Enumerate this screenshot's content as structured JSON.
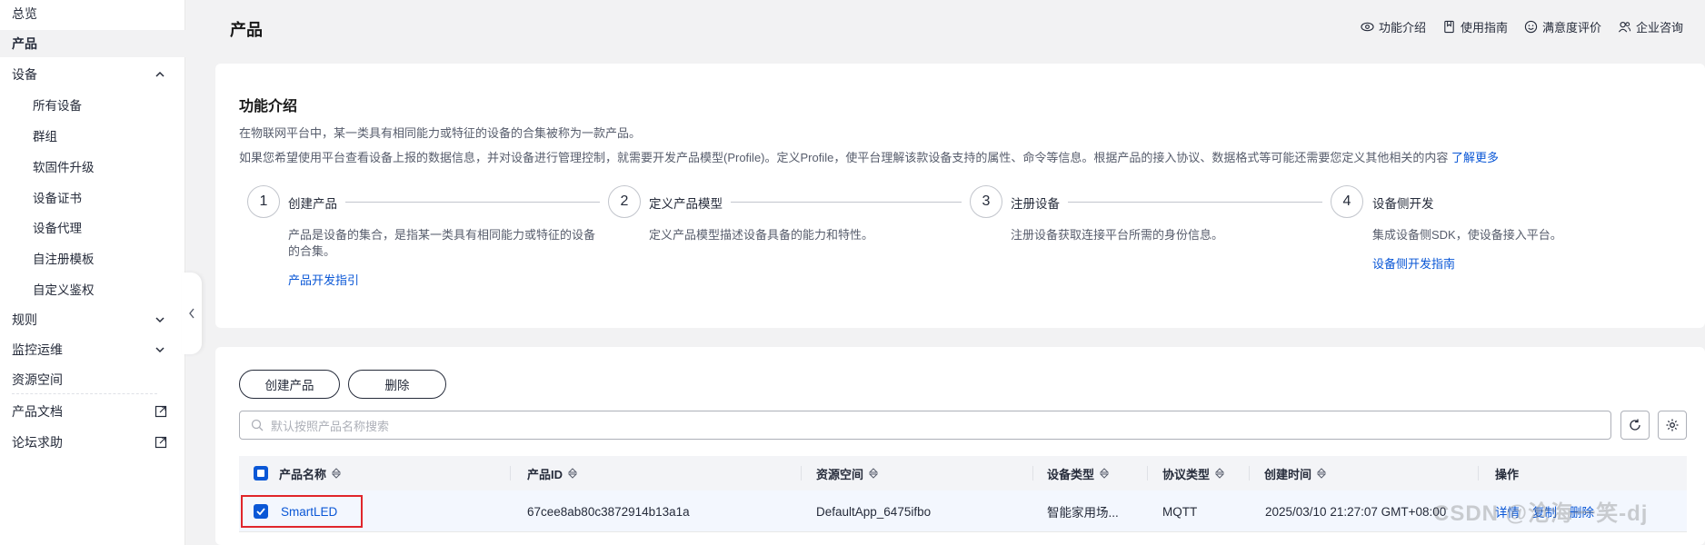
{
  "sidebar": {
    "items": [
      {
        "label": "总览"
      },
      {
        "label": "产品"
      },
      {
        "label": "设备"
      },
      {
        "label": "所有设备"
      },
      {
        "label": "群组"
      },
      {
        "label": "软固件升级"
      },
      {
        "label": "设备证书"
      },
      {
        "label": "设备代理"
      },
      {
        "label": "自注册模板"
      },
      {
        "label": "自定义鉴权"
      },
      {
        "label": "规则"
      },
      {
        "label": "监控运维"
      },
      {
        "label": "资源空间"
      },
      {
        "label": "产品文档"
      },
      {
        "label": "论坛求助"
      }
    ]
  },
  "header": {
    "title": "产品",
    "links": [
      "功能介绍",
      "使用指南",
      "满意度评价",
      "企业咨询"
    ]
  },
  "intro": {
    "title": "功能介绍",
    "p1": "在物联网平台中，某一类具有相同能力或特征的设备的合集被称为一款产品。",
    "p2": "如果您希望使用平台查看设备上报的数据信息，并对设备进行管理控制，就需要开发产品模型(Profile)。定义Profile，使平台理解该款设备支持的属性、命令等信息。根据产品的接入协议、数据格式等可能还需要您定义其他相关的内容",
    "p2_link": "了解更多",
    "steps": [
      {
        "num": "1",
        "title": "创建产品",
        "desc": "产品是设备的集合，是指某一类具有相同能力或特征的设备的合集。",
        "link": "产品开发指引"
      },
      {
        "num": "2",
        "title": "定义产品模型",
        "desc": "定义产品模型描述设备具备的能力和特性。",
        "link": ""
      },
      {
        "num": "3",
        "title": "注册设备",
        "desc": "注册设备获取连接平台所需的身份信息。",
        "link": ""
      },
      {
        "num": "4",
        "title": "设备侧开发",
        "desc": "集成设备侧SDK，使设备接入平台。",
        "link": "设备侧开发指南"
      }
    ]
  },
  "list": {
    "create_label": "创建产品",
    "delete_label": "删除",
    "search_placeholder": "默认按照产品名称搜索",
    "columns": [
      "产品名称",
      "产品ID",
      "资源空间",
      "设备类型",
      "协议类型",
      "创建时间",
      "操作"
    ],
    "rows": [
      {
        "name": "SmartLED",
        "id": "67cee8ab80c3872914b13a1a",
        "space": "DefaultApp_6475ifbo",
        "type": "智能家用场...",
        "protocol": "MQTT",
        "created": "2025/03/10 21:27:07 GMT+08:00",
        "actions": [
          "详情",
          "复制",
          "删除"
        ]
      }
    ]
  },
  "watermark": "CSDN @沧海一笑-dj",
  "colors": {
    "accent": "#0a57d6",
    "highlight": "#e0262c"
  }
}
